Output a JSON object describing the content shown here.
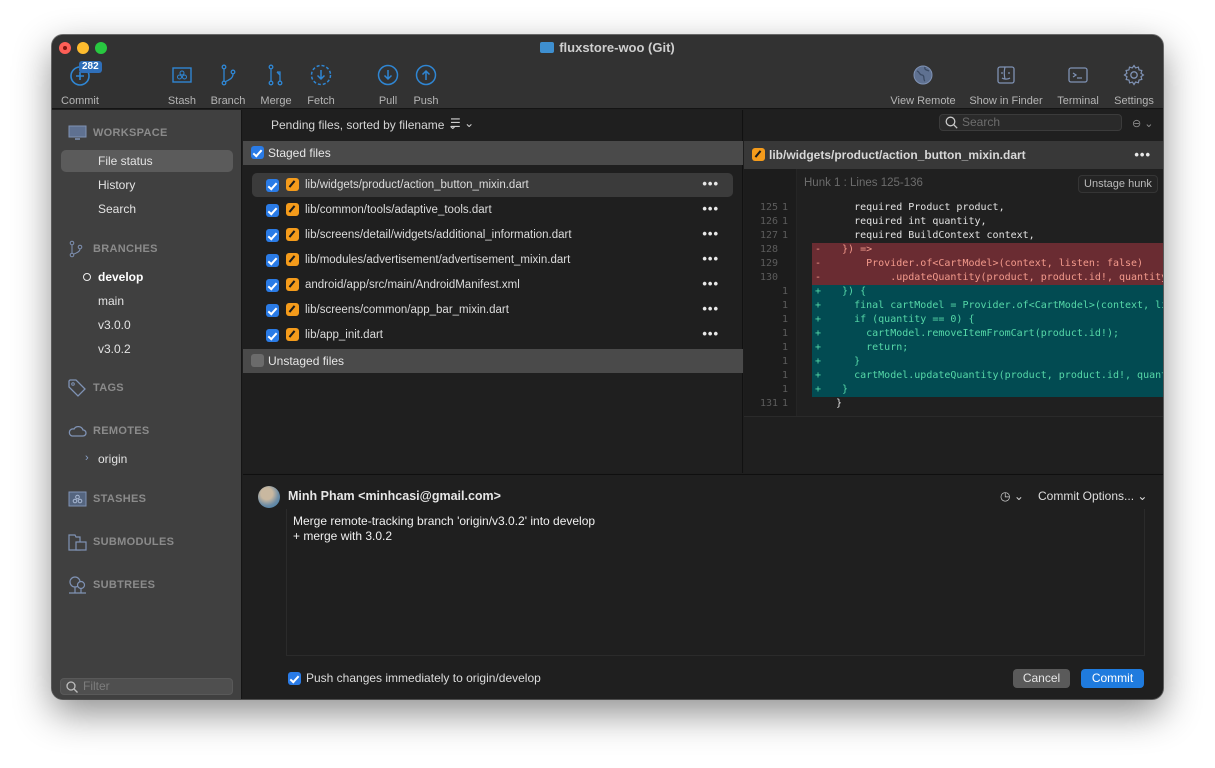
{
  "window": {
    "title": "fluxstore-woo (Git)"
  },
  "toolbar": {
    "commit": {
      "label": "Commit",
      "badge": "282"
    },
    "stash": {
      "label": "Stash"
    },
    "branch": {
      "label": "Branch"
    },
    "merge": {
      "label": "Merge"
    },
    "fetch": {
      "label": "Fetch"
    },
    "pull": {
      "label": "Pull"
    },
    "push": {
      "label": "Push"
    },
    "view_remote": {
      "label": "View Remote"
    },
    "show_in_finder": {
      "label": "Show in Finder"
    },
    "terminal": {
      "label": "Terminal"
    },
    "settings": {
      "label": "Settings"
    }
  },
  "sidebar": {
    "workspace": {
      "header": "WORKSPACE",
      "items": [
        {
          "label": "File status",
          "selected": true
        },
        {
          "label": "History"
        },
        {
          "label": "Search"
        }
      ]
    },
    "branches": {
      "header": "BRANCHES",
      "items": [
        {
          "label": "develop",
          "current": true
        },
        {
          "label": "main"
        },
        {
          "label": "v3.0.0"
        },
        {
          "label": "v3.0.2"
        }
      ]
    },
    "tags": {
      "header": "TAGS"
    },
    "remotes": {
      "header": "REMOTES",
      "items": [
        {
          "label": "origin"
        }
      ]
    },
    "stashes": {
      "header": "STASHES"
    },
    "submodules": {
      "header": "SUBMODULES"
    },
    "subtrees": {
      "header": "SUBTREES"
    },
    "filter_placeholder": "Filter"
  },
  "files": {
    "sort_label": "Pending files, sorted by filename",
    "staged": {
      "header": "Staged files",
      "checked": true,
      "items": [
        {
          "path": "lib/widgets/product/action_button_mixin.dart",
          "status": "modified",
          "selected": true
        },
        {
          "path": "lib/common/tools/adaptive_tools.dart",
          "status": "modified"
        },
        {
          "path": "lib/screens/detail/widgets/additional_information.dart",
          "status": "modified"
        },
        {
          "path": "lib/modules/advertisement/advertisement_mixin.dart",
          "status": "modified"
        },
        {
          "path": "android/app/src/main/AndroidManifest.xml",
          "status": "modified"
        },
        {
          "path": "lib/screens/common/app_bar_mixin.dart",
          "status": "modified"
        },
        {
          "path": "lib/app_init.dart",
          "status": "modified"
        }
      ]
    },
    "unstaged": {
      "header": "Unstaged files",
      "checked": false
    }
  },
  "diff": {
    "search_placeholder": "Search",
    "file_path": "lib/widgets/product/action_button_mixin.dart",
    "hunk_header": "Hunk 1 : Lines 125-136",
    "unstage_label": "Unstage hunk",
    "colors": {
      "deleted_bg": "#6a2c32",
      "added_bg": "#024b52"
    },
    "lines": [
      {
        "type": "ctx",
        "old": "125",
        "new": "1",
        "mark": "",
        "text": "    required Product product,"
      },
      {
        "type": "ctx",
        "old": "126",
        "new": "1",
        "mark": "",
        "text": "    required int quantity,"
      },
      {
        "type": "ctx",
        "old": "127",
        "new": "1",
        "mark": "",
        "text": "    required BuildContext context,"
      },
      {
        "type": "del",
        "old": "128",
        "new": "",
        "mark": "-",
        "text": "  }) =>"
      },
      {
        "type": "del",
        "old": "129",
        "new": "",
        "mark": "-",
        "text": "      Provider.of<CartModel>(context, listen: false)"
      },
      {
        "type": "del",
        "old": "130",
        "new": "",
        "mark": "-",
        "text": "          .updateQuantity(product, product.id!, quantity);"
      },
      {
        "type": "add",
        "old": "",
        "new": "1",
        "mark": "+",
        "text": "  }) {"
      },
      {
        "type": "add",
        "old": "",
        "new": "1",
        "mark": "+",
        "text": "    final cartModel = Provider.of<CartModel>(context, listen"
      },
      {
        "type": "add",
        "old": "",
        "new": "1",
        "mark": "+",
        "text": "    if (quantity == 0) {"
      },
      {
        "type": "add",
        "old": "",
        "new": "1",
        "mark": "+",
        "text": "      cartModel.removeItemFromCart(product.id!);"
      },
      {
        "type": "add",
        "old": "",
        "new": "1",
        "mark": "+",
        "text": "      return;"
      },
      {
        "type": "add",
        "old": "",
        "new": "1",
        "mark": "+",
        "text": "    }"
      },
      {
        "type": "add",
        "old": "",
        "new": "1",
        "mark": "+",
        "text": "    cartModel.updateQuantity(product, product.id!, quantity)"
      },
      {
        "type": "add",
        "old": "",
        "new": "1",
        "mark": "+",
        "text": "  }"
      },
      {
        "type": "ctx",
        "old": "131",
        "new": "1",
        "mark": "",
        "text": " }"
      }
    ]
  },
  "commit": {
    "author": "Minh Pham <minhcasi@gmail.com>",
    "options_label": "Commit Options...",
    "message": "Merge remote-tracking branch 'origin/v3.0.2' into develop\n+ merge with 3.0.2",
    "push_label": "Push changes immediately to origin/develop",
    "push_checked": true,
    "cancel_label": "Cancel",
    "commit_label": "Commit"
  }
}
